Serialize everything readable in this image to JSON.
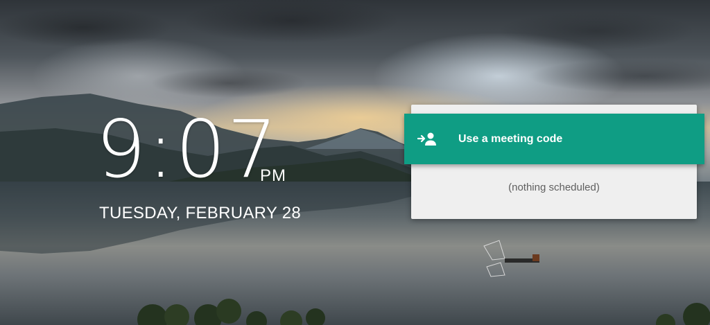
{
  "clock": {
    "time": "9:07",
    "ampm": "PM",
    "date": "TUESDAY, FEBRUARY 28"
  },
  "meeting_panel": {
    "button_label": "Use a meeting code",
    "button_icon": "person-arrow-icon",
    "empty_text": "(nothing scheduled)"
  },
  "colors": {
    "accent": "#0f9d84",
    "panel_background": "#efefef",
    "text_muted": "#5f5f5f"
  },
  "background": {
    "scene": "lake with mountains and clouds at dusk"
  }
}
